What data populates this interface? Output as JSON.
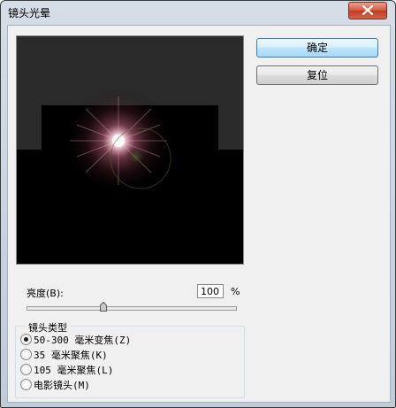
{
  "window": {
    "title": "镜头光晕"
  },
  "buttons": {
    "ok": "确定",
    "reset": "复位"
  },
  "brightness": {
    "label": "亮度(B):",
    "value": "100",
    "unit": "%",
    "slider_fraction": 0.37
  },
  "lens_type": {
    "legend": "镜头类型",
    "options": [
      {
        "label": "50-300 毫米变焦(Z)",
        "selected": true
      },
      {
        "label": "35 毫米聚焦(K)",
        "selected": false
      },
      {
        "label": "105 毫米聚焦(L)",
        "selected": false
      },
      {
        "label": "电影镜头(M)",
        "selected": false
      }
    ]
  },
  "icons": {
    "close": "close-icon",
    "slider_thumb": "slider-thumb-icon"
  },
  "colors": {
    "preview_bg": "#000000",
    "preview_frame": "#2b2b2b",
    "flare_core": "#ffffff",
    "flare_glow": "#e7a0b6"
  }
}
